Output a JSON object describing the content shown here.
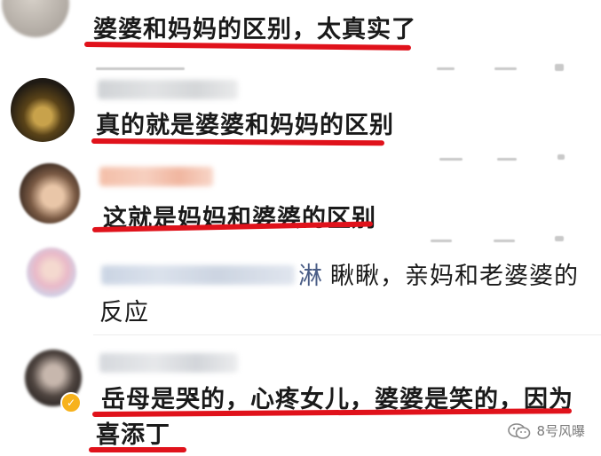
{
  "comments": [
    {
      "text": "婆婆和妈妈的区别，太真实了"
    },
    {
      "text": "真的就是婆婆和妈妈的区别"
    },
    {
      "text": "这就是妈妈和婆婆的区别"
    },
    {
      "name_visible": "淋",
      "text_line1": "瞅瞅，亲妈和老婆婆的",
      "text_line2": "反应"
    },
    {
      "text_line1": "岳母是哭的，心疼女儿，婆婆是笑的，因为",
      "text_line2": "喜添丁"
    }
  ],
  "watermark": "8号风曝",
  "colors": {
    "underline": "#e0121b",
    "text": "#1a1a1a"
  }
}
